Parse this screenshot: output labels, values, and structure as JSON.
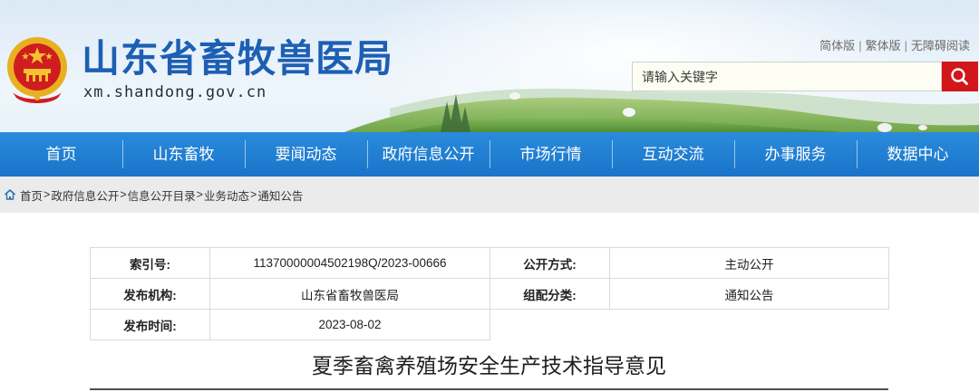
{
  "header": {
    "site_name": "山东省畜牧兽医局",
    "domain": "xm.shandong.gov.cn",
    "links": [
      "简体版",
      "繁体版",
      "无障碍阅读"
    ],
    "link_separator": "|",
    "search_placeholder": "请输入关键字",
    "search_button_color": "#d2171b"
  },
  "nav": {
    "items": [
      "首页",
      "山东畜牧",
      "要闻动态",
      "政府信息公开",
      "市场行情",
      "互动交流",
      "办事服务",
      "数据中心"
    ],
    "color": "#1a74c9"
  },
  "breadcrumb": {
    "items": [
      "首页",
      "政府信息公开",
      "信息公开目录",
      "业务动态",
      "通知公告"
    ],
    "separator": ">"
  },
  "info": {
    "index_label": "索引号:",
    "index_value": "11370000004502198Q/2023-00666",
    "open_mode_label": "公开方式:",
    "open_mode_value": "主动公开",
    "publisher_label": "发布机构:",
    "publisher_value": "山东省畜牧兽医局",
    "category_label": "组配分类:",
    "category_value": "通知公告",
    "date_label": "发布时间:",
    "date_value": "2023-08-02"
  },
  "article": {
    "title": "夏季畜禽养殖场安全生产技术指导意见"
  }
}
